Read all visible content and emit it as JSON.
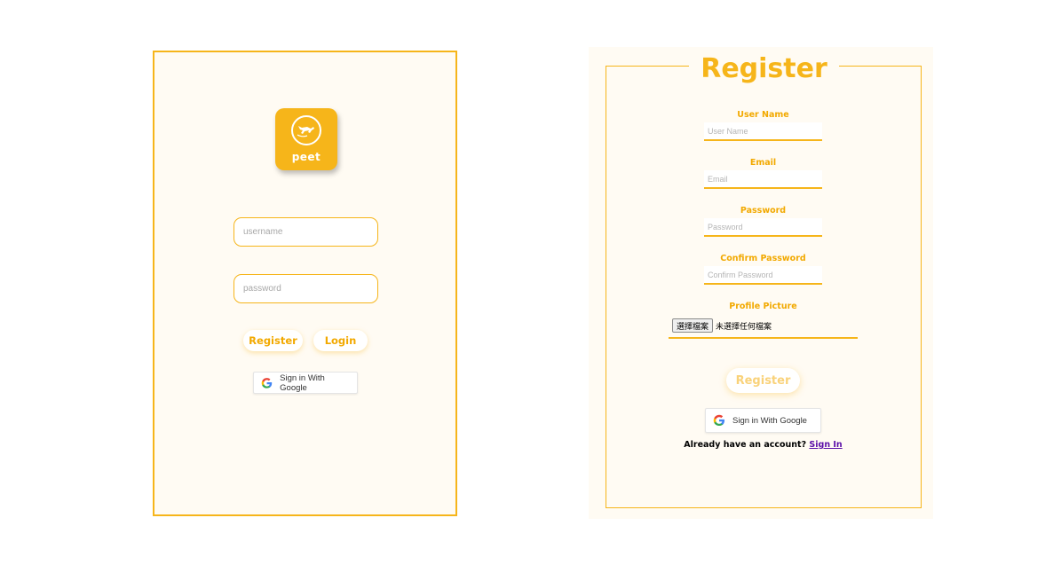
{
  "login_panel": {
    "logo": {
      "icon": "running-animal-icon",
      "text": "peet",
      "color": "#f6b51a"
    },
    "username_placeholder": "username",
    "password_placeholder": "password",
    "register_label": "Register",
    "login_label": "Login",
    "google_label": "Sign in With Google"
  },
  "register_panel": {
    "title": "Register",
    "fields": [
      {
        "label": "User Name",
        "placeholder": "User Name"
      },
      {
        "label": "Email",
        "placeholder": "Email"
      },
      {
        "label": "Password",
        "placeholder": "Password"
      },
      {
        "label": "Confirm Password",
        "placeholder": "Confirm Password"
      }
    ],
    "profile_picture": {
      "label": "Profile Picture",
      "button_label": "選擇檔案",
      "status": "未選擇任何檔案"
    },
    "submit_label": "Register",
    "google_label": "Sign in With Google",
    "account_prompt": "Already have an account?",
    "signin_link": "Sign In"
  },
  "colors": {
    "accent": "#f6b51a",
    "panel_bg": "#fffbf3",
    "link": "#5b0ea8"
  }
}
